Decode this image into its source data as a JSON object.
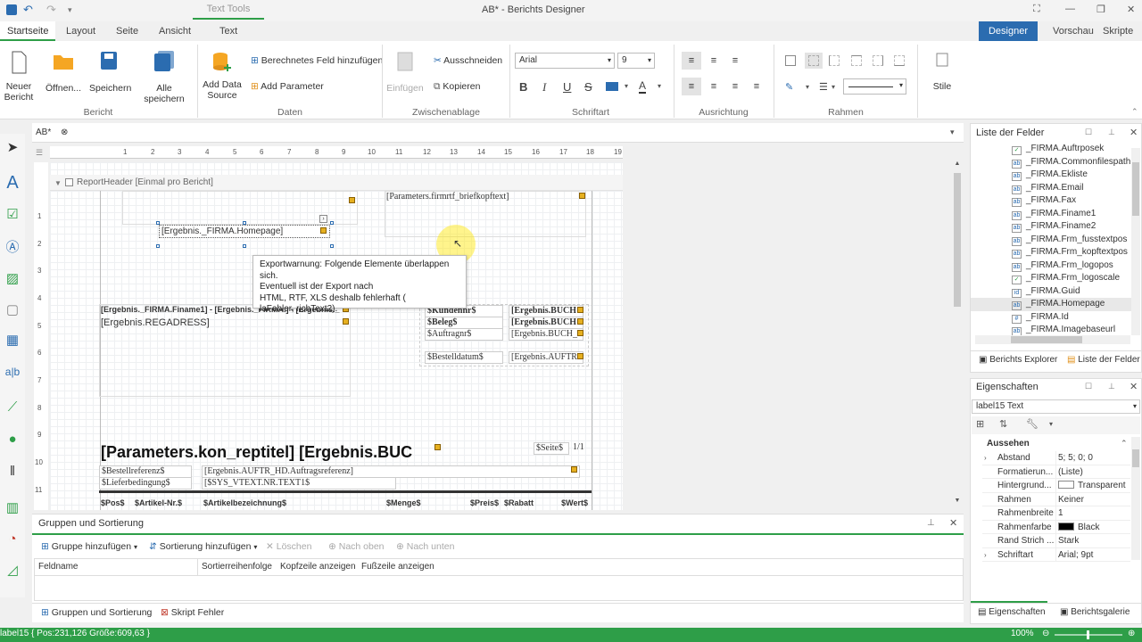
{
  "window": {
    "title": "AB* - Berichts Designer",
    "context_tab": "Text Tools"
  },
  "tabs": [
    "Startseite",
    "Layout",
    "Seite",
    "Ansicht",
    "Text"
  ],
  "view_buttons": {
    "designer": "Designer",
    "preview": "Vorschau",
    "scripts": "Skripte"
  },
  "ribbon": {
    "bericht": {
      "label": "Bericht",
      "neu": "Neuer Bericht",
      "oeffnen": "Öffnen...",
      "speichern": "Speichern",
      "alle": "Alle speichern"
    },
    "daten": {
      "label": "Daten",
      "add_source": "Add Data Source",
      "calc_field": "Berechnetes Feld hinzufügen",
      "add_param": "Add Parameter"
    },
    "zwischenablage": {
      "label": "Zwischenablage",
      "einfuegen": "Einfügen",
      "ausschneiden": "Ausschneiden",
      "kopieren": "Kopieren"
    },
    "schriftart": {
      "label": "Schriftart",
      "font": "Arial",
      "size": "9"
    },
    "ausrichtung": {
      "label": "Ausrichtung"
    },
    "rahmen": {
      "label": "Rahmen"
    },
    "stile": {
      "label": "Stile"
    }
  },
  "document_tab": "AB*",
  "ruler_h": [
    "1",
    "2",
    "3",
    "4",
    "5",
    "6",
    "7",
    "8",
    "9",
    "10",
    "11",
    "12",
    "13",
    "14",
    "15",
    "16",
    "17",
    "18",
    "19"
  ],
  "ruler_v": [
    "1",
    "2",
    "3",
    "4",
    "5",
    "6",
    "7",
    "8",
    "9",
    "10",
    "11"
  ],
  "band_title": "ReportHeader [Einmal pro Bericht]",
  "controls": {
    "briefkopf": "[Parameters.firmrtf_briefkopftext]",
    "homepage": "[Ergebnis._FIRMA.Homepage]",
    "finame": "[Ergebnis._FIRMA.Finame1] - [Ergebnis._FIRMA.] - [Ergebnis._",
    "regadress": "[Ergebnis.REGADRESS]",
    "kundennr": "$Kundennr$",
    "beleg": "$Beleg$",
    "auftragnr": "$Auftragnr$",
    "bestelldatum": "$Bestelldatum$",
    "buch1": "[Ergebnis.BUCH",
    "buch2": "[Ergebnis.BUCH",
    "buch3": "[Ergebnis.BUCH_",
    "auftr": "[Ergebnis.AUFTR",
    "reptitel": "[Parameters.kon_reptitel] [Ergebnis.BUC",
    "seite": "$Seite$",
    "seite_val": "1/1",
    "bestellreferenz": "$Bestellreferenz$",
    "bestellref_val": "[Ergebnis.AUFTR_HD.Auftragsreferenz]",
    "lieferbedingung": "$Lieferbedingung$",
    "lieferbed_val": "[$SYS_VTEXT.NR.TEXT1$",
    "pos": "$Pos$",
    "artikelnr": "$Artikel-Nr.$",
    "artikelbez": "$Artikelbezeichnung$",
    "menge": "$Menge$",
    "preis": "$Preis$",
    "rabatt": "$Rabatt",
    "wert": "$Wert$"
  },
  "tooltip": [
    "Exportwarnung: Folgende Elemente überlappen sich.",
    "Eventuell ist der Export nach",
    "HTML, RTF, XLS deshalb fehlerhaft  (",
    "laFehler, richText2)."
  ],
  "groups_panel": {
    "title": "Gruppen und Sortierung",
    "add_group": "Gruppe hinzufügen",
    "add_sort": "Sortierung hinzufügen",
    "delete": "Löschen",
    "up": "Nach oben",
    "down": "Nach unten",
    "columns": [
      "Feldname",
      "Sortierreihenfolge",
      "Kopfzeile anzeigen",
      "Fußzeile anzeigen"
    ],
    "tab1": "Gruppen und Sortierung",
    "tab2": "Skript Fehler"
  },
  "field_list": {
    "title": "Liste der Felder",
    "items": [
      {
        "icon": "check",
        "name": "_FIRMA.Auftrposek"
      },
      {
        "icon": "ab",
        "name": "_FIRMA.Commonfilespath"
      },
      {
        "icon": "ab",
        "name": "_FIRMA.Ekliste"
      },
      {
        "icon": "ab",
        "name": "_FIRMA.Email"
      },
      {
        "icon": "ab",
        "name": "_FIRMA.Fax"
      },
      {
        "icon": "ab",
        "name": "_FIRMA.Finame1"
      },
      {
        "icon": "ab",
        "name": "_FIRMA.Finame2"
      },
      {
        "icon": "ab",
        "name": "_FIRMA.Frm_fusstextpos"
      },
      {
        "icon": "ab",
        "name": "_FIRMA.Frm_kopftextpos"
      },
      {
        "icon": "ab",
        "name": "_FIRMA.Frm_logopos"
      },
      {
        "icon": "check",
        "name": "_FIRMA.Frm_logoscale"
      },
      {
        "icon": "id",
        "name": "_FIRMA.Guid"
      },
      {
        "icon": "ab",
        "name": "_FIRMA.Homepage"
      },
      {
        "icon": "num",
        "name": "_FIRMA.Id"
      },
      {
        "icon": "ab",
        "name": "_FIRMA.Imagebaseurl"
      }
    ],
    "tab1": "Berichts Explorer",
    "tab2": "Liste der Felder"
  },
  "properties": {
    "title": "Eigenschaften",
    "selected": "label15   Text",
    "section": "Aussehen",
    "rows": [
      {
        "name": "Abstand",
        "value": "5; 5; 0; 0",
        "expand": true
      },
      {
        "name": "Formatierun...",
        "value": "(Liste)",
        "expand": false
      },
      {
        "name": "Hintergrund...",
        "value": "Transparent",
        "expand": false,
        "swatch": "#ffffff"
      },
      {
        "name": "Rahmen",
        "value": "Keiner",
        "expand": false
      },
      {
        "name": "Rahmenbreite",
        "value": "1",
        "expand": false
      },
      {
        "name": "Rahmenfarbe",
        "value": "Black",
        "expand": false,
        "swatch": "#000000"
      },
      {
        "name": "Rand Strich ...",
        "value": "Stark",
        "expand": false
      },
      {
        "name": "Schriftart",
        "value": "Arial; 9pt",
        "expand": true
      }
    ],
    "tab1": "Eigenschaften",
    "tab2": "Berichtsgalerie"
  },
  "status": {
    "left": "label15 { Pos:231,126 Größe:609,63 }",
    "zoom": "100%"
  },
  "colors": {
    "accent": "#2b6cb0",
    "green": "#2e9e48"
  }
}
